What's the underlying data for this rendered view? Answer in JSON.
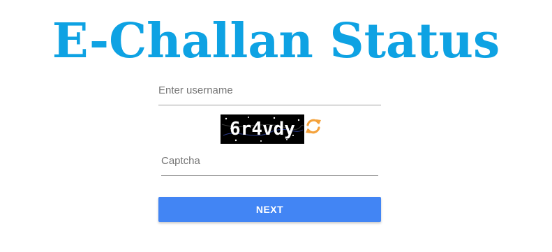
{
  "header": {
    "title": "E-Challan Status"
  },
  "form": {
    "username": {
      "placeholder": "Enter username",
      "value": ""
    },
    "captcha_image": {
      "text": "6r4vdy"
    },
    "refresh_icon": "refresh-icon",
    "captcha_input": {
      "placeholder": "Captcha",
      "value": ""
    },
    "next_button": {
      "label": "NEXT"
    }
  },
  "colors": {
    "title": "#0ea2e3",
    "button": "#4285f4",
    "refresh_icon": "#f4a23c",
    "captcha_background": "#000000"
  }
}
